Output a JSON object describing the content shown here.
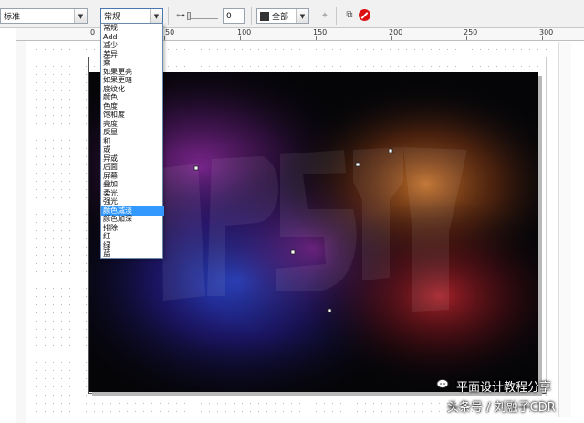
{
  "toolbar": {
    "preset": "标准",
    "merge_mode": "常规",
    "transparency_value": "0",
    "target": "全部"
  },
  "ruler": {
    "labels": [
      "0",
      "50",
      "100",
      "150",
      "200",
      "250",
      "300"
    ]
  },
  "merge_modes": [
    "常规",
    "Add",
    "减少",
    "差异",
    "乘",
    "如果更亮",
    "如果更暗",
    "底纹化",
    "颜色",
    "色度",
    "饱和度",
    "亮度",
    "反显",
    "和",
    "或",
    "异或",
    "后面",
    "屏幕",
    "叠加",
    "柔光",
    "强光",
    "颜色减淡",
    "颜色加深",
    "排除",
    "红",
    "绿",
    "蓝"
  ],
  "selected_merge_mode": "颜色减淡",
  "watermark": {
    "line1": "平面设计教程分享",
    "line2": "头条号 / 刘融子CDR"
  },
  "colors": {
    "selection": "#3399ff",
    "background": "#050508"
  }
}
